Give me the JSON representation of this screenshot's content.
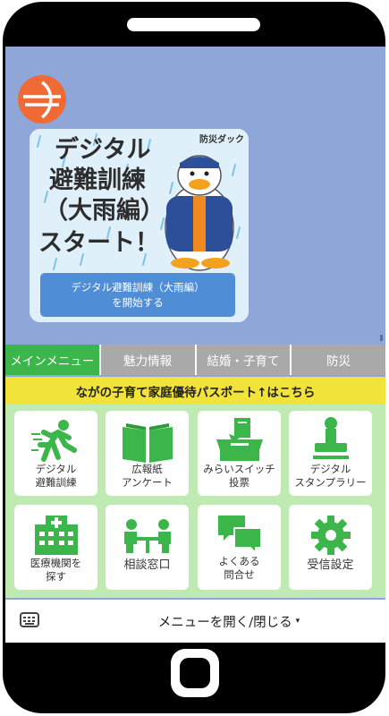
{
  "banner": {
    "title_lines": [
      "デジタル",
      "避難訓練",
      "（大雨編）",
      "スタート！"
    ],
    "character_label": "防災ダック",
    "button_lines": [
      "デジタル避難訓練（大雨編）",
      "を開始する"
    ]
  },
  "tabs": [
    {
      "label": "メインメニュー",
      "active": true
    },
    {
      "label": "魅力情報",
      "active": false
    },
    {
      "label": "結婚・子育て",
      "active": false
    },
    {
      "label": "防災",
      "active": false
    }
  ],
  "passport_banner": "ながの子育て家庭優待パスポート↑はこちら",
  "menu_tiles": [
    {
      "icon": "running-person-icon",
      "lines": [
        "デジタル",
        "避難訓練"
      ]
    },
    {
      "icon": "open-book-icon",
      "lines": [
        "広報紙",
        "アンケート"
      ]
    },
    {
      "icon": "ballot-box-icon",
      "lines": [
        "みらいスイッチ",
        "投票"
      ]
    },
    {
      "icon": "stamp-icon",
      "lines": [
        "デジタル",
        "スタンプラリー"
      ]
    },
    {
      "icon": "hospital-icon",
      "lines": [
        "医療機関を",
        "探す"
      ]
    },
    {
      "icon": "consultation-icon",
      "lines": [
        "相談窓口"
      ]
    },
    {
      "icon": "speech-bubbles-icon",
      "lines": [
        "よくある",
        "問合せ"
      ]
    },
    {
      "icon": "gear-icon",
      "lines": [
        "受信設定"
      ]
    }
  ],
  "bottom_bar": {
    "menu_label": "メニューを開く/閉じる",
    "caret": "▾"
  },
  "colors": {
    "screen_bg": "#8fa6d8",
    "accent_green": "#3cb54a",
    "tile_area_bg": "#bfeab1",
    "passport_yellow": "#f2e33a",
    "button_blue": "#4f8ed6",
    "logo_orange": "#f06a36"
  }
}
